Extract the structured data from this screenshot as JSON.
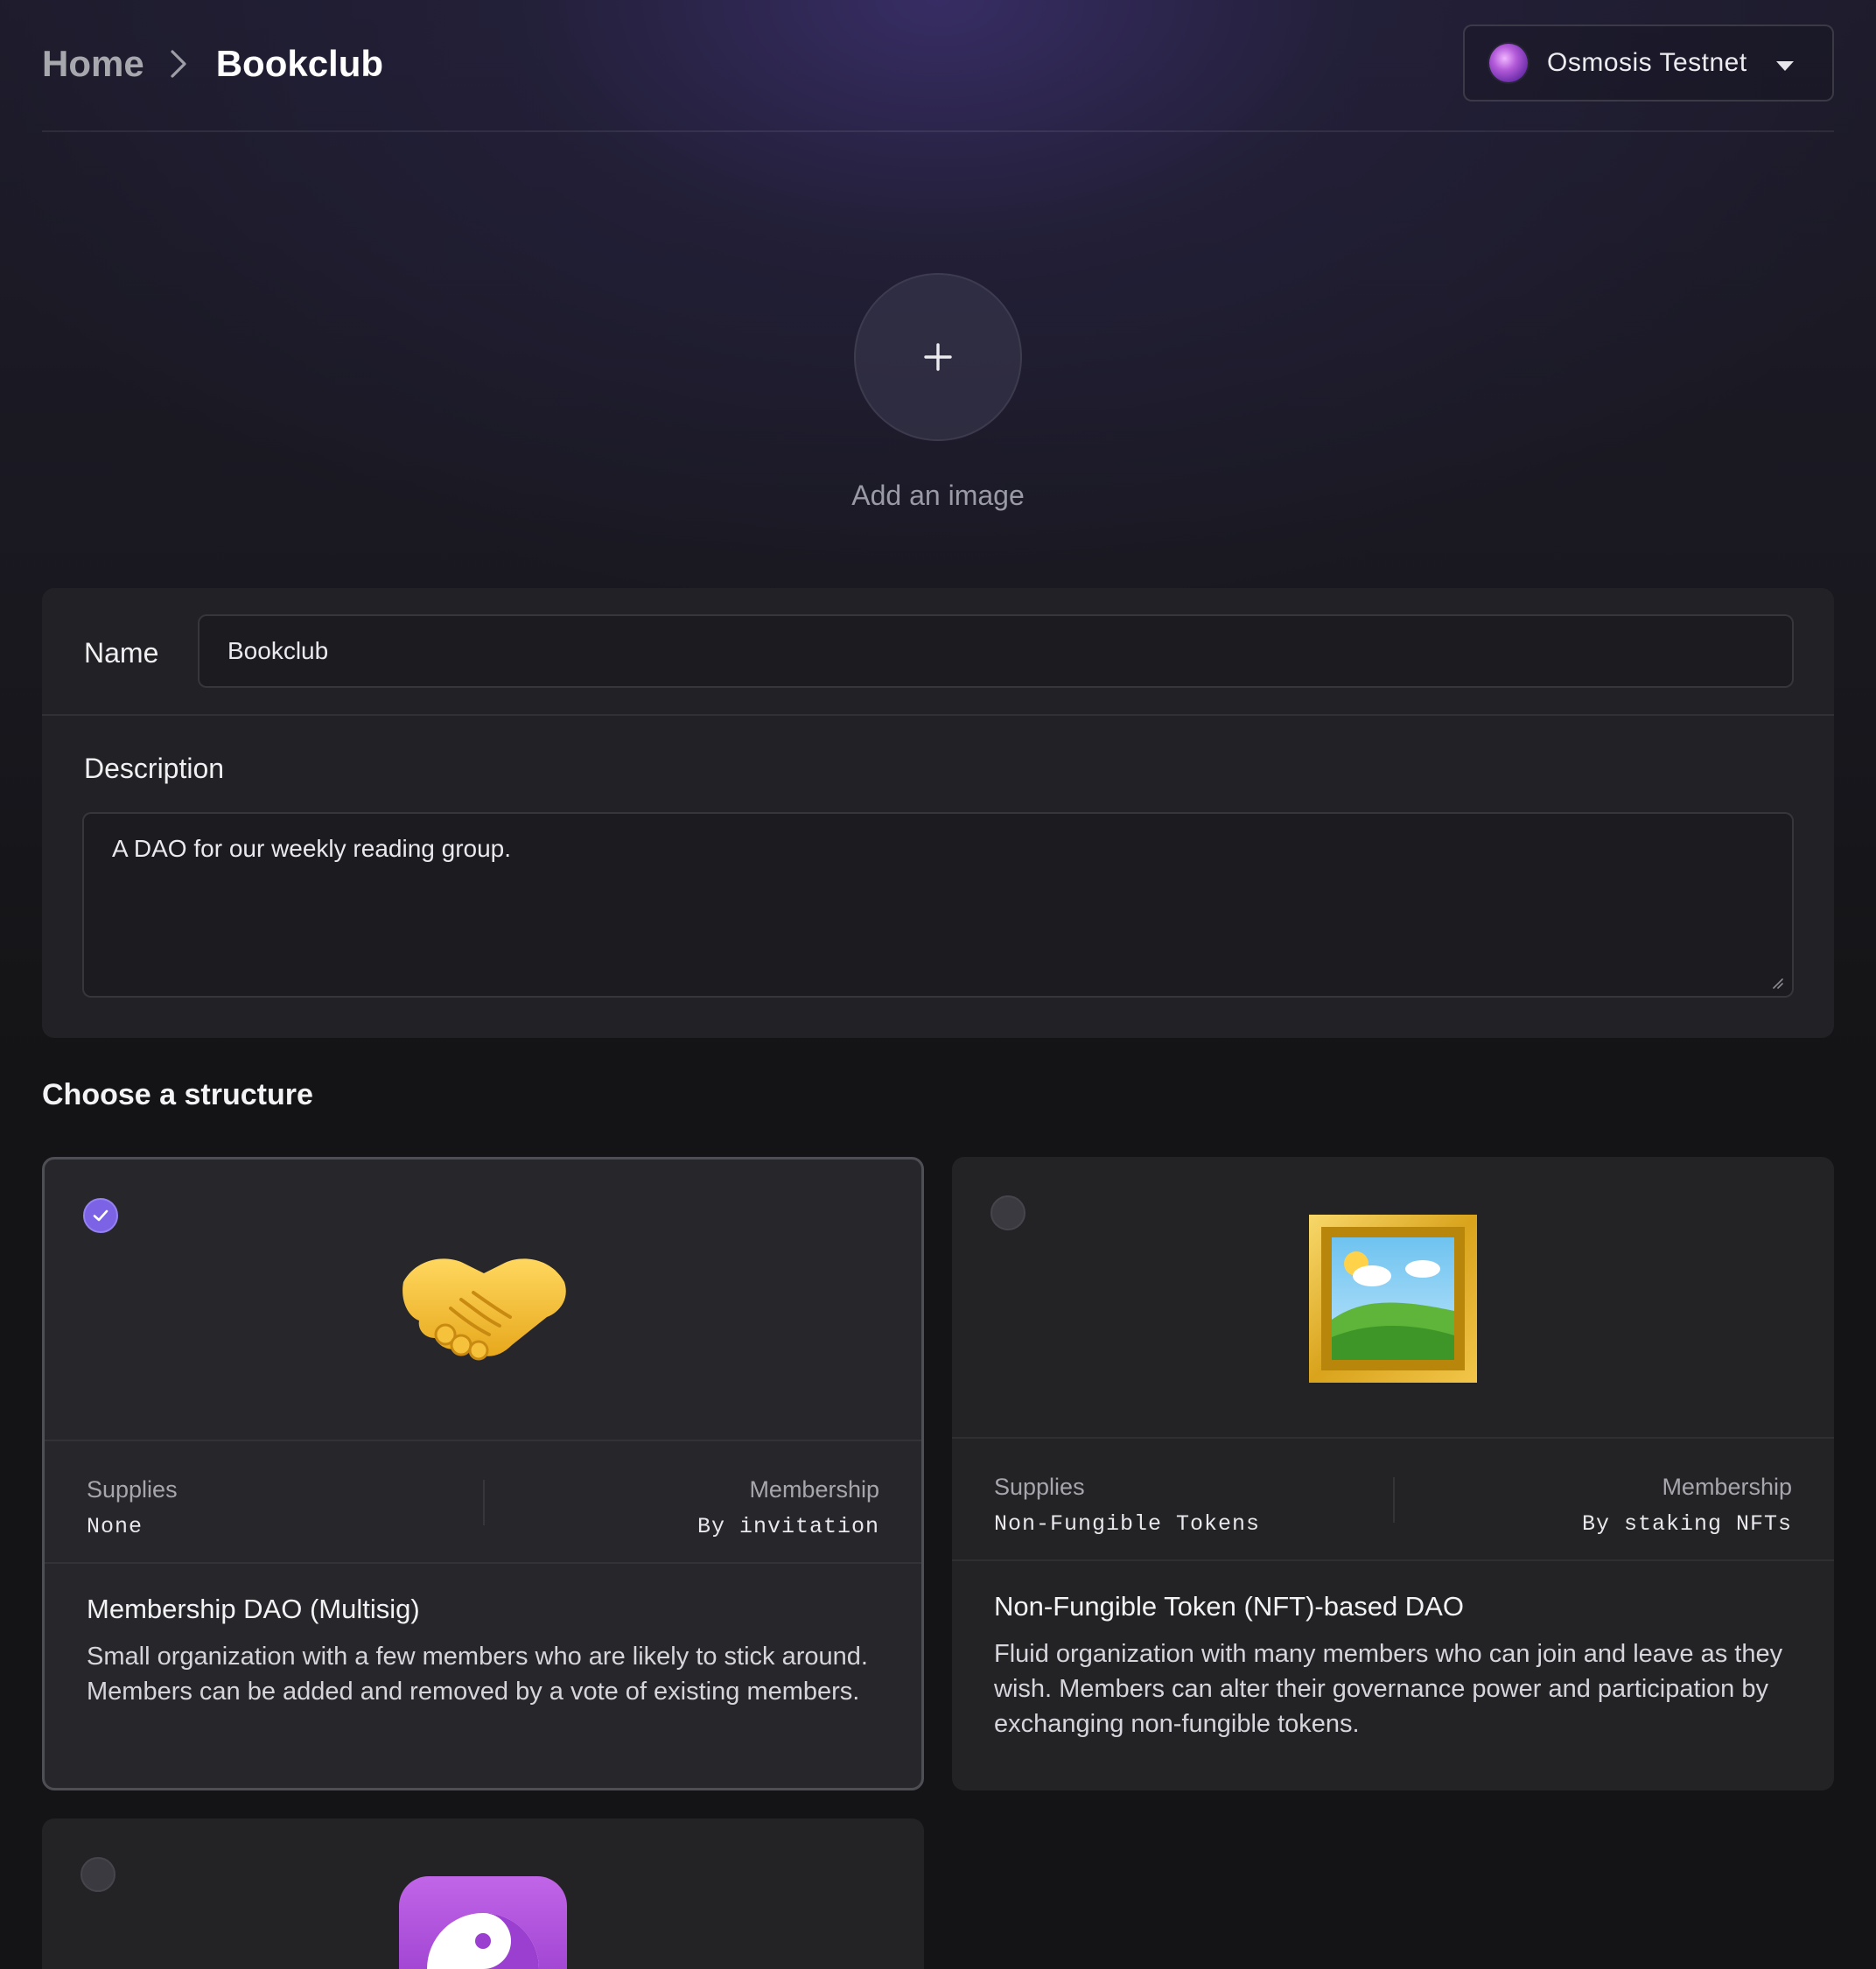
{
  "breadcrumb": {
    "home": "Home",
    "current": "Bookclub"
  },
  "network": {
    "name": "Osmosis Testnet",
    "icon": "osmosis-logo-icon"
  },
  "image_picker": {
    "label": "Add an image",
    "icon": "plus-icon"
  },
  "form": {
    "name_label": "Name",
    "name_value": "Bookclub",
    "description_label": "Description",
    "description_value": "A DAO for our weekly reading group."
  },
  "structure": {
    "title": "Choose a structure",
    "options": [
      {
        "selected": true,
        "icon": "handshake-icon",
        "supplies_label": "Supplies",
        "supplies_value": "None",
        "membership_label": "Membership",
        "membership_value": "By invitation",
        "title": "Membership DAO (Multisig)",
        "description": "Small organization with a few members who are likely to stick around. Members can be added and removed by a vote of existing members."
      },
      {
        "selected": false,
        "icon": "framed-picture-icon",
        "supplies_label": "Supplies",
        "supplies_value": "Non-Fungible Tokens",
        "membership_label": "Membership",
        "membership_value": "By staking NFTs",
        "title": "Non-Fungible Token (NFT)-based DAO",
        "description": "Fluid organization with many members who can join and leave as they wish. Members can alter their governance power and participation by exchanging non-fungible tokens."
      },
      {
        "selected": false,
        "icon": "yin-yang-icon"
      }
    ]
  },
  "colors": {
    "accent": "#7c63e6",
    "background": "#141416",
    "panel": "#222226"
  }
}
